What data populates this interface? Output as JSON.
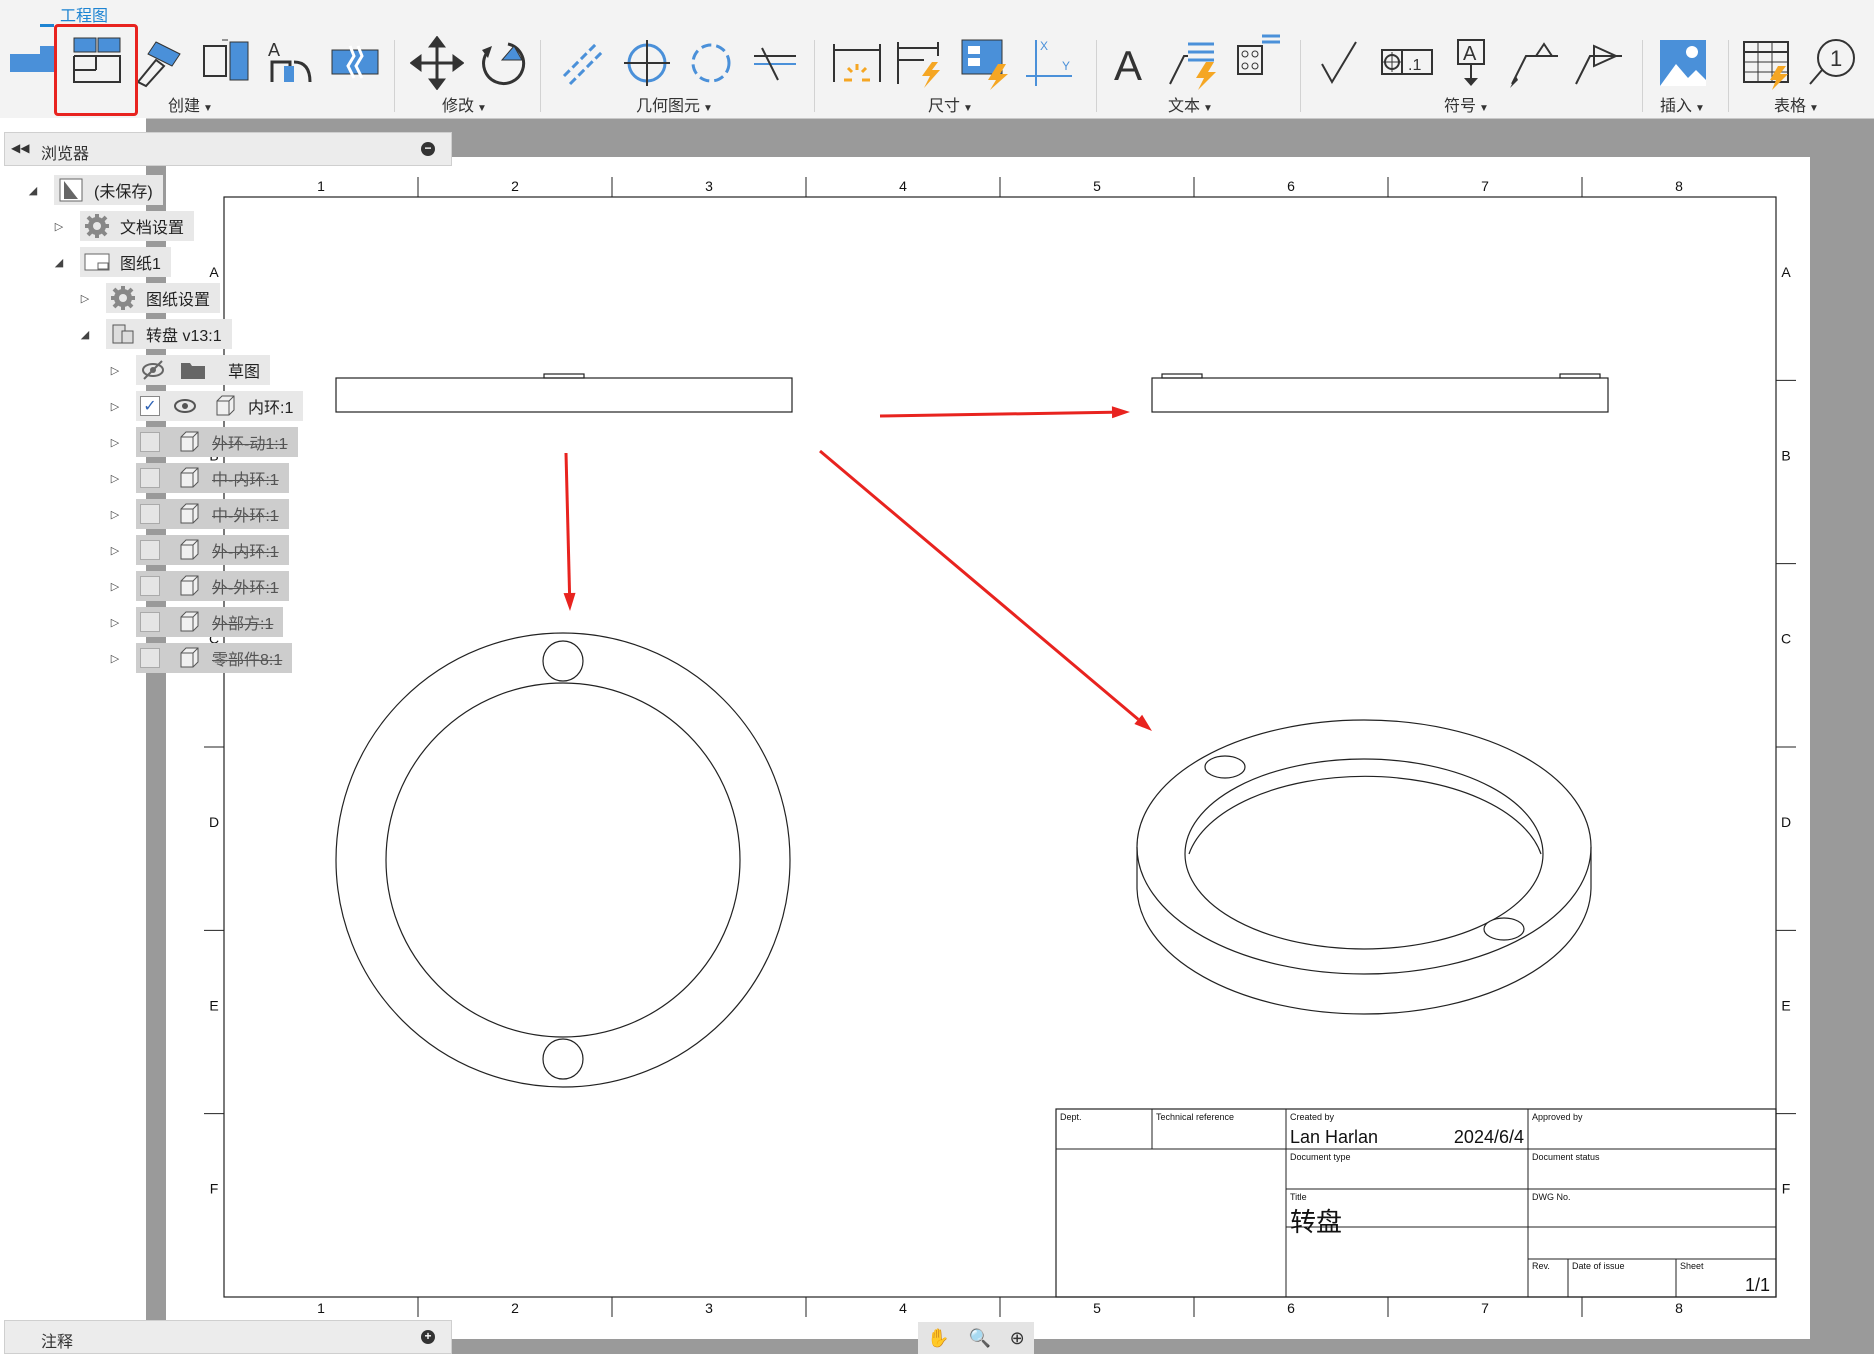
{
  "toolbar": {
    "tab": "工程图",
    "groups": {
      "create": "创建",
      "modify": "修改",
      "geometry": "几何图元",
      "dimension": "尺寸",
      "text": "文本",
      "symbol": "符号",
      "insert": "插入",
      "table": "表格"
    }
  },
  "browser": {
    "title": "浏览器",
    "items": [
      {
        "label": "(未保存)"
      },
      {
        "label": "文档设置"
      },
      {
        "label": "图纸1"
      },
      {
        "label": "图纸设置"
      },
      {
        "label": "转盘 v13:1"
      },
      {
        "label": "草图"
      },
      {
        "label": "内环:1"
      },
      {
        "label": "外环-动1:1"
      },
      {
        "label": "中-内环:1"
      },
      {
        "label": "中-外环:1"
      },
      {
        "label": "外-内环:1"
      },
      {
        "label": "外-外环:1"
      },
      {
        "label": "外部方:1"
      },
      {
        "label": "零部件8:1"
      }
    ]
  },
  "sheet": {
    "col_labels": [
      "1",
      "2",
      "3",
      "4",
      "5",
      "6",
      "7",
      "8"
    ],
    "row_labels": [
      "A",
      "B",
      "C",
      "D",
      "E",
      "F"
    ],
    "title_block": {
      "dept_label": "Dept.",
      "techref_label": "Technical reference",
      "created_by_label": "Created by",
      "created_by": "Lan Harlan",
      "date": "2024/6/4",
      "approved_by_label": "Approved by",
      "doc_type_label": "Document type",
      "doc_status_label": "Document status",
      "title_label": "Title",
      "title": "转盘",
      "dwg_no_label": "DWG No.",
      "rev_label": "Rev.",
      "date_issue_label": "Date of issue",
      "sheet_label": "Sheet",
      "sheet": "1/1"
    }
  },
  "notes": {
    "title": "注释"
  },
  "colors": {
    "accent": "#1e84d2",
    "arrow": "#e8231f",
    "highlight": "#e8231f"
  }
}
